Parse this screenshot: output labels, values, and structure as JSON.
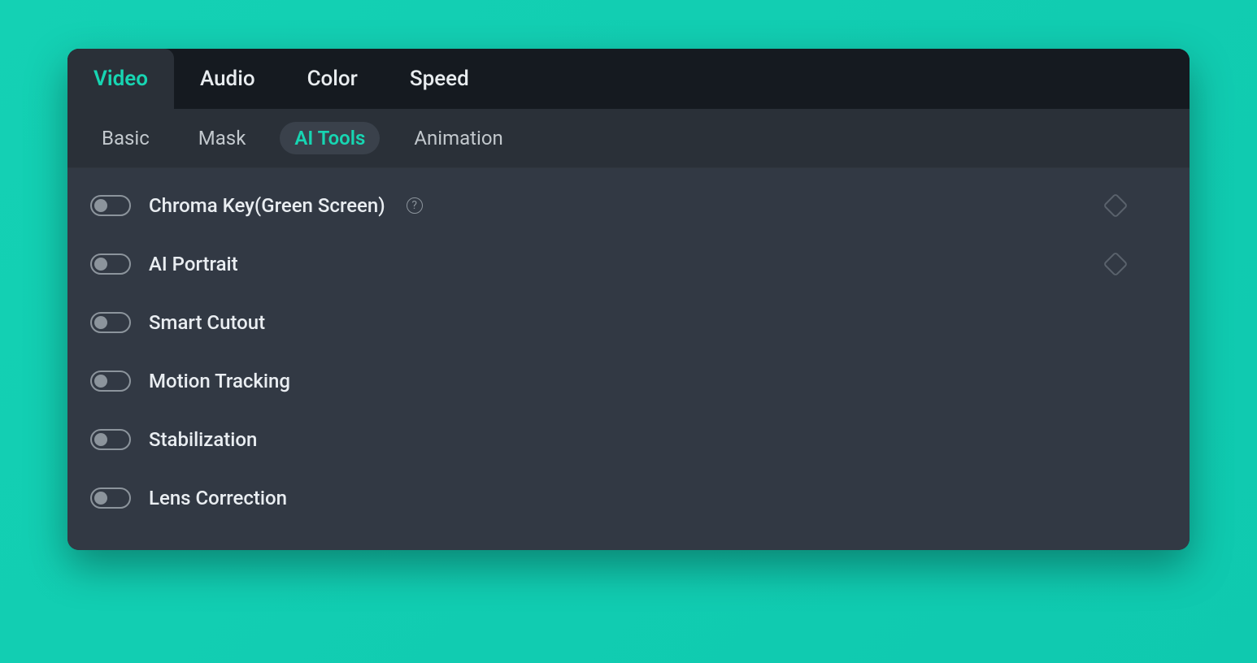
{
  "primaryTabs": [
    {
      "label": "Video",
      "active": true
    },
    {
      "label": "Audio",
      "active": false
    },
    {
      "label": "Color",
      "active": false
    },
    {
      "label": "Speed",
      "active": false
    }
  ],
  "secondaryTabs": [
    {
      "label": "Basic",
      "active": false
    },
    {
      "label": "Mask",
      "active": false
    },
    {
      "label": "AI Tools",
      "active": true
    },
    {
      "label": "Animation",
      "active": false
    }
  ],
  "options": [
    {
      "label": "Chroma Key(Green Screen)",
      "on": false,
      "help": true,
      "keyframe": true
    },
    {
      "label": "AI Portrait",
      "on": false,
      "help": false,
      "keyframe": true
    },
    {
      "label": "Smart Cutout",
      "on": false,
      "help": false,
      "keyframe": false
    },
    {
      "label": "Motion Tracking",
      "on": false,
      "help": false,
      "keyframe": false
    },
    {
      "label": "Stabilization",
      "on": false,
      "help": false,
      "keyframe": false
    },
    {
      "label": "Lens Correction",
      "on": false,
      "help": false,
      "keyframe": false
    }
  ],
  "helpGlyph": "?"
}
